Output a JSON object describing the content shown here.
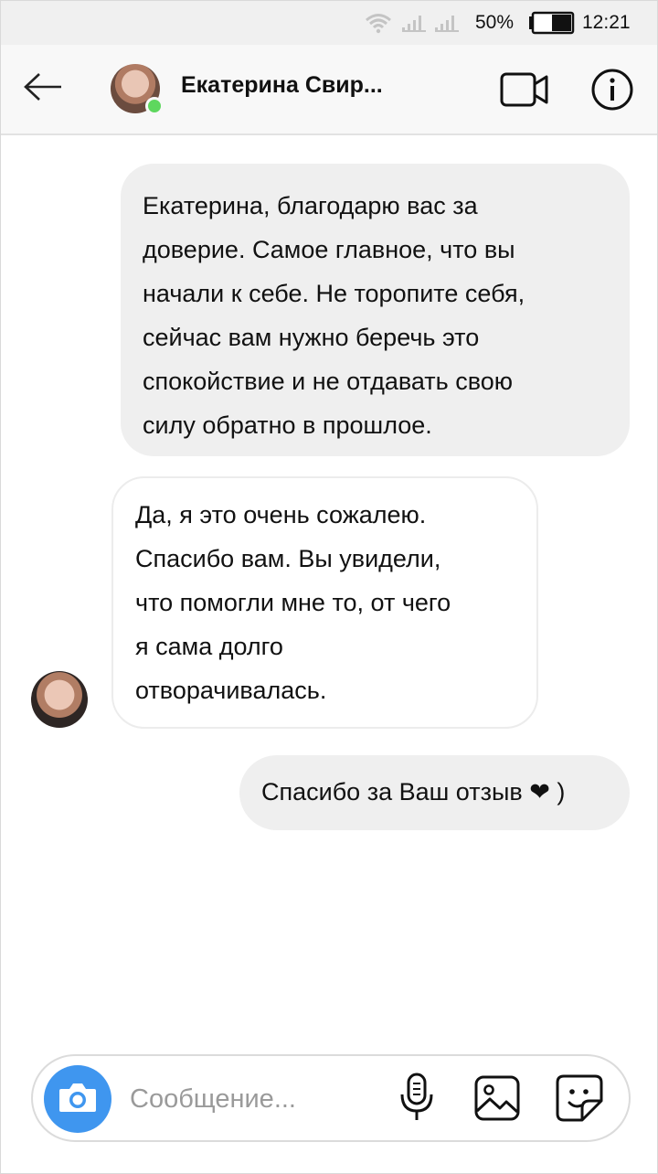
{
  "status_bar": {
    "battery_percent": "50%",
    "time": "12:21",
    "icons": [
      "wifi-icon",
      "signal-icon",
      "signal-icon",
      "battery-icon"
    ]
  },
  "header": {
    "contact_name": "Екатерина Свир...",
    "online": true,
    "icons": {
      "back": "arrow-left-icon",
      "video": "video-camera-icon",
      "info": "info-icon"
    }
  },
  "messages": [
    {
      "direction": "outgoing",
      "lines": [
        "Екатерина, благодарю вас за",
        "доверие. Самое главное, что вы",
        "начали к себе. Не торопите себя,",
        "сейчас вам нужно беречь это",
        "спокойствие и не отдавать свою",
        "силу обратно в прошлое."
      ]
    },
    {
      "direction": "incoming",
      "lines": [
        "Да, я это очень сожалею.",
        "Спасибо вам. Вы увидели,",
        "что помогли мне то, от чего",
        "я сама долго",
        "отворачивалась."
      ]
    },
    {
      "direction": "outgoing",
      "lines": [
        "Спасибо за Ваш отзыв ❤ )"
      ]
    }
  ],
  "composer": {
    "placeholder": "Сообщение...",
    "value": "",
    "icons": {
      "camera": "camera-icon",
      "mic": "microphone-icon",
      "gallery": "image-icon",
      "sticker": "sticker-icon"
    }
  },
  "colors": {
    "accent": "#3f96ef",
    "online": "#5ed75e",
    "outgoing_bubble": "#efefef",
    "header_bg": "#f8f8f8"
  }
}
